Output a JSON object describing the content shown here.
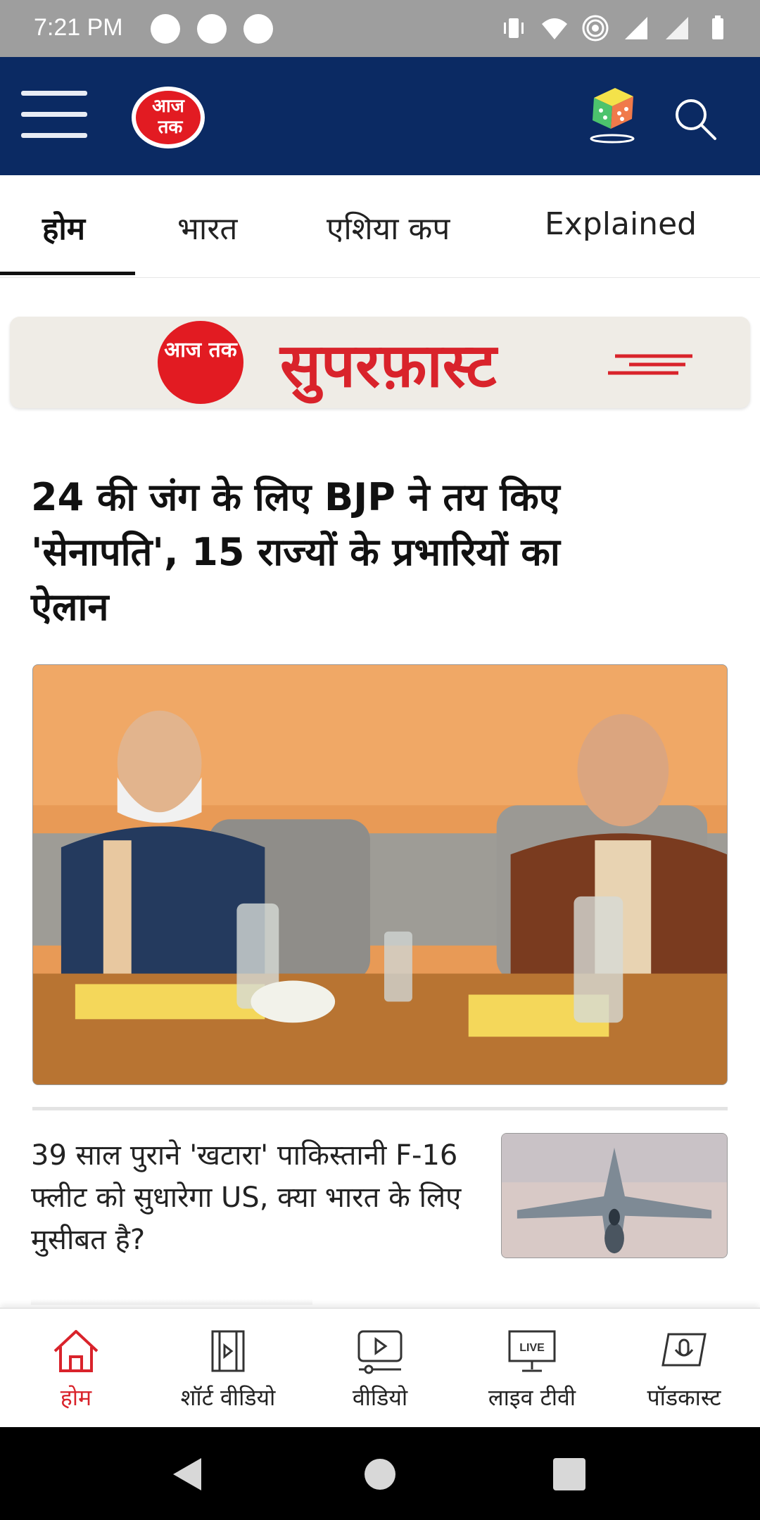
{
  "status_bar": {
    "time": "7:21 PM"
  },
  "header": {
    "logo_alt": "आज तक"
  },
  "tabs": [
    {
      "label": "होम",
      "active": true
    },
    {
      "label": "भारत",
      "active": false
    },
    {
      "label": "एशिया कप",
      "active": false
    },
    {
      "label": "Explained",
      "active": false
    }
  ],
  "banner": {
    "logo_text": "आज तक",
    "title": "सुपरफ़ास्ट"
  },
  "lead_story": {
    "headline": "24 की जंग के लिए BJP ने तय किए 'सेनापति', 15 राज्यों के प्रभारियों का ऐलान"
  },
  "story_2": {
    "headline": "39 साल पुराने 'खटारा' पाकिस्तानी F-16 फ्लीट को सुधारेगा US, क्या भारत के लिए मुसीबत है?"
  },
  "bottom_nav": [
    {
      "label": "होम",
      "icon": "home-icon",
      "active": true
    },
    {
      "label": "शॉर्ट वीडियो",
      "icon": "short-video-icon",
      "active": false
    },
    {
      "label": "वीडियो",
      "icon": "video-icon",
      "active": false
    },
    {
      "label": "लाइव टीवी",
      "icon": "live-tv-icon",
      "active": false
    },
    {
      "label": "पॉडकास्ट",
      "icon": "podcast-icon",
      "active": false
    }
  ],
  "colors": {
    "header_bg": "#0b2a63",
    "brand_red": "#d9232b",
    "status_bar_bg": "#9e9e9e"
  }
}
